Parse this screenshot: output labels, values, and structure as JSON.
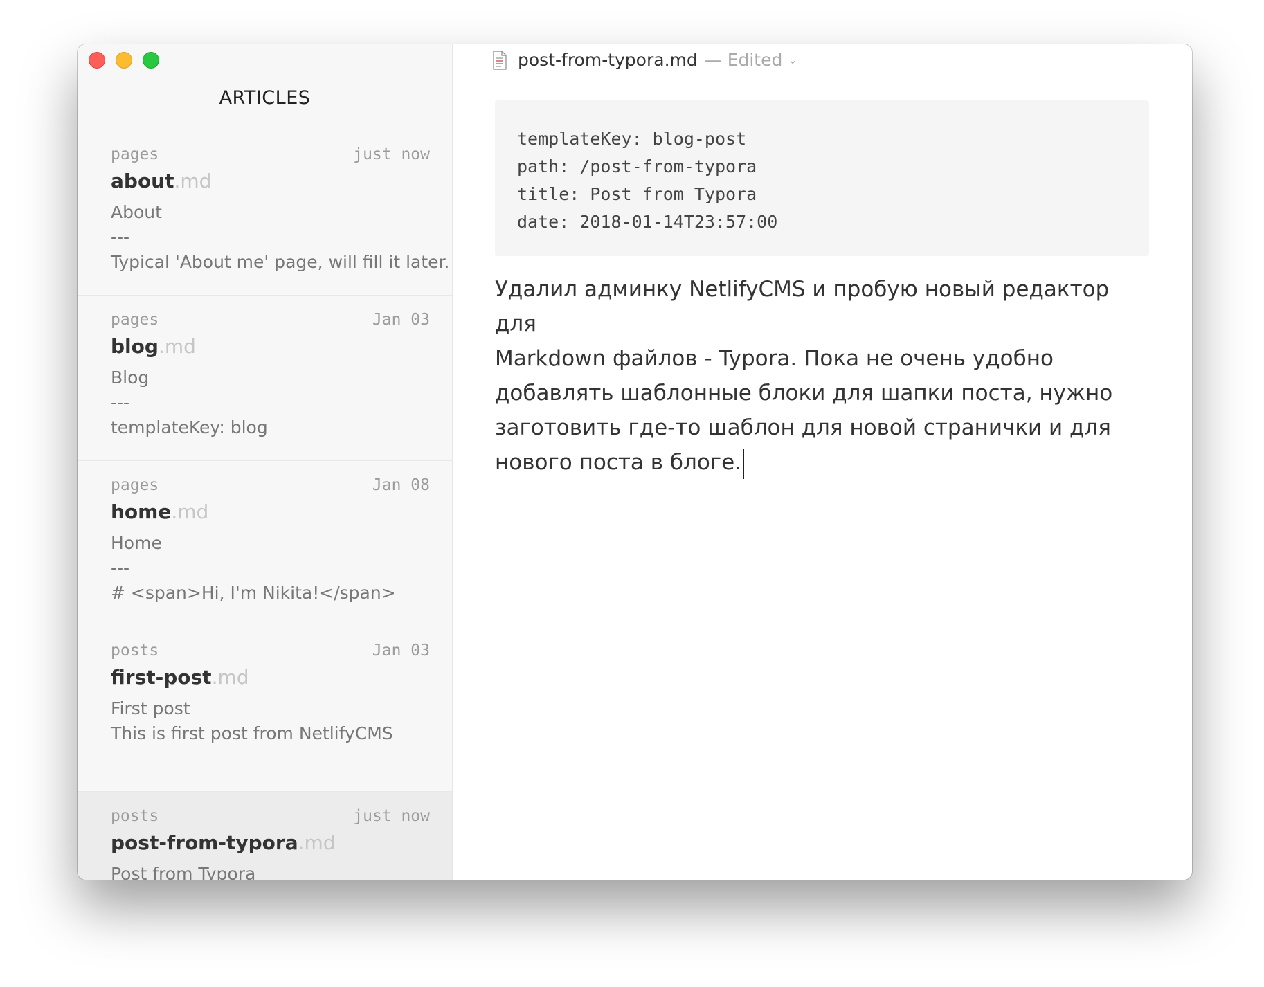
{
  "sidebar": {
    "title": "ARTICLES",
    "files": [
      {
        "folder": "pages",
        "time": "just now",
        "name": "about",
        "ext": ".md",
        "line1": "About",
        "line2": "---",
        "line3": "Typical 'About me' page, will fill it later."
      },
      {
        "folder": "pages",
        "time": "Jan 03",
        "name": "blog",
        "ext": ".md",
        "line1": "Blog",
        "line2": "---",
        "line3": "templateKey: blog"
      },
      {
        "folder": "pages",
        "time": "Jan 08",
        "name": "home",
        "ext": ".md",
        "line1": "Home",
        "line2": "---",
        "line3": "# <span>Hi, I'm Nikita!</span>"
      },
      {
        "folder": "posts",
        "time": "Jan 03",
        "name": "first-post",
        "ext": ".md",
        "line1": "First post",
        "line2": "This is first post from NetlifyCMS",
        "line3": ""
      },
      {
        "folder": "posts",
        "time": "just now",
        "name": "post-from-typora",
        "ext": ".md",
        "line1": "Post from Typora",
        "line2": "",
        "line3": ""
      }
    ]
  },
  "editor": {
    "title": "post-from-typora.md",
    "status": "— Edited",
    "frontmatter": [
      "templateKey: blog-post",
      "path: /post-from-typora",
      "title: Post from Typora",
      "date: 2018-01-14T23:57:00"
    ],
    "body_lines": [
      "Удалил админку NetlifyCMS и пробую новый редактор для",
      "Markdown файлов - Typora. Пока не очень удобно",
      "добавлять шаблонные блоки для шапки поста, нужно",
      "заготовить где-то шаблон для новой странички и для",
      "нового поста в блоге."
    ]
  }
}
